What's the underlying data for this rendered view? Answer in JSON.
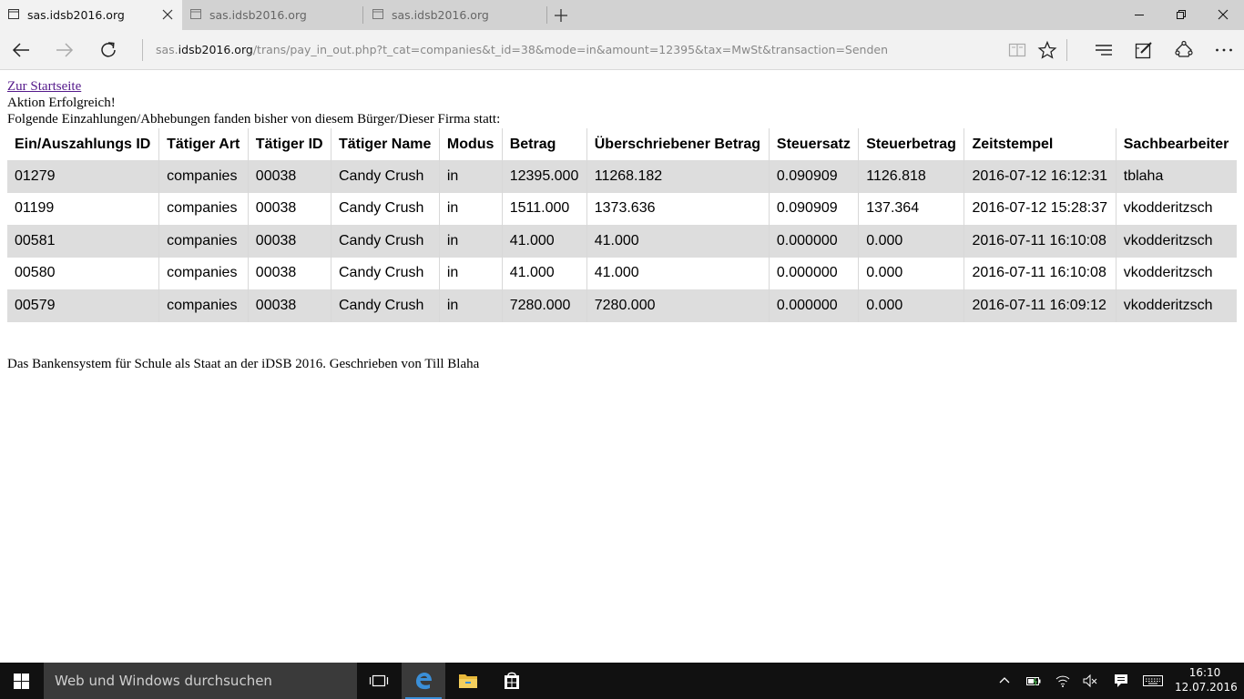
{
  "browser": {
    "tabs": [
      {
        "title": "sas.idsb2016.org",
        "active": true
      },
      {
        "title": "sas.idsb2016.org",
        "active": false
      },
      {
        "title": "sas.idsb2016.org",
        "active": false
      }
    ],
    "address": {
      "prefix": "sas.",
      "host": "idsb2016.org",
      "path": "/trans/pay_in_out.php?t_cat=companies&t_id=38&mode=in&amount=12395&tax=MwSt&transaction=Senden"
    },
    "icons": {
      "back": "back-arrow-icon",
      "forward": "forward-arrow-icon",
      "refresh": "refresh-icon",
      "reading_view": "reading-view-icon",
      "favorite": "star-icon",
      "hub": "hub-icon",
      "web_note": "web-note-icon",
      "share": "share-icon",
      "more": "more-icon"
    }
  },
  "page": {
    "home_link": "Zur Startseite",
    "status": "Aktion Erfolgreich!",
    "intro": "Folgende Einzahlungen/Abhebungen fanden bisher von diesem Bürger/Dieser Firma statt:",
    "footer": "Das Bankensystem für Schule als Staat an der iDSB 2016. Geschrieben von Till Blaha",
    "table": {
      "headers": [
        "Ein/Auszahlungs ID",
        "Tätiger Art",
        "Tätiger ID",
        "Tätiger Name",
        "Modus",
        "Betrag",
        "Überschriebener Betrag",
        "Steuersatz",
        "Steuerbetrag",
        "Zeitstempel",
        "Sachbearbeiter"
      ],
      "rows": [
        [
          "01279",
          "companies",
          "00038",
          "Candy Crush",
          "in",
          "12395.000",
          "11268.182",
          "0.090909",
          "1126.818",
          "2016-07-12 16:12:31",
          "tblaha"
        ],
        [
          "01199",
          "companies",
          "00038",
          "Candy Crush",
          "in",
          "1511.000",
          "1373.636",
          "0.090909",
          "137.364",
          "2016-07-12 15:28:37",
          "vkodderitzsch"
        ],
        [
          "00581",
          "companies",
          "00038",
          "Candy Crush",
          "in",
          "41.000",
          "41.000",
          "0.000000",
          "0.000",
          "2016-07-11 16:10:08",
          "vkodderitzsch"
        ],
        [
          "00580",
          "companies",
          "00038",
          "Candy Crush",
          "in",
          "41.000",
          "41.000",
          "0.000000",
          "0.000",
          "2016-07-11 16:10:08",
          "vkodderitzsch"
        ],
        [
          "00579",
          "companies",
          "00038",
          "Candy Crush",
          "in",
          "7280.000",
          "7280.000",
          "0.000000",
          "0.000",
          "2016-07-11 16:09:12",
          "vkodderitzsch"
        ]
      ],
      "colors": {
        "odd_row": "#dddddd",
        "even_row": "#ffffff"
      }
    }
  },
  "taskbar": {
    "search_placeholder": "Web und Windows durchsuchen",
    "clock_time": "16:10",
    "clock_date": "12.07.2016",
    "accent": "#3a8fd8"
  }
}
